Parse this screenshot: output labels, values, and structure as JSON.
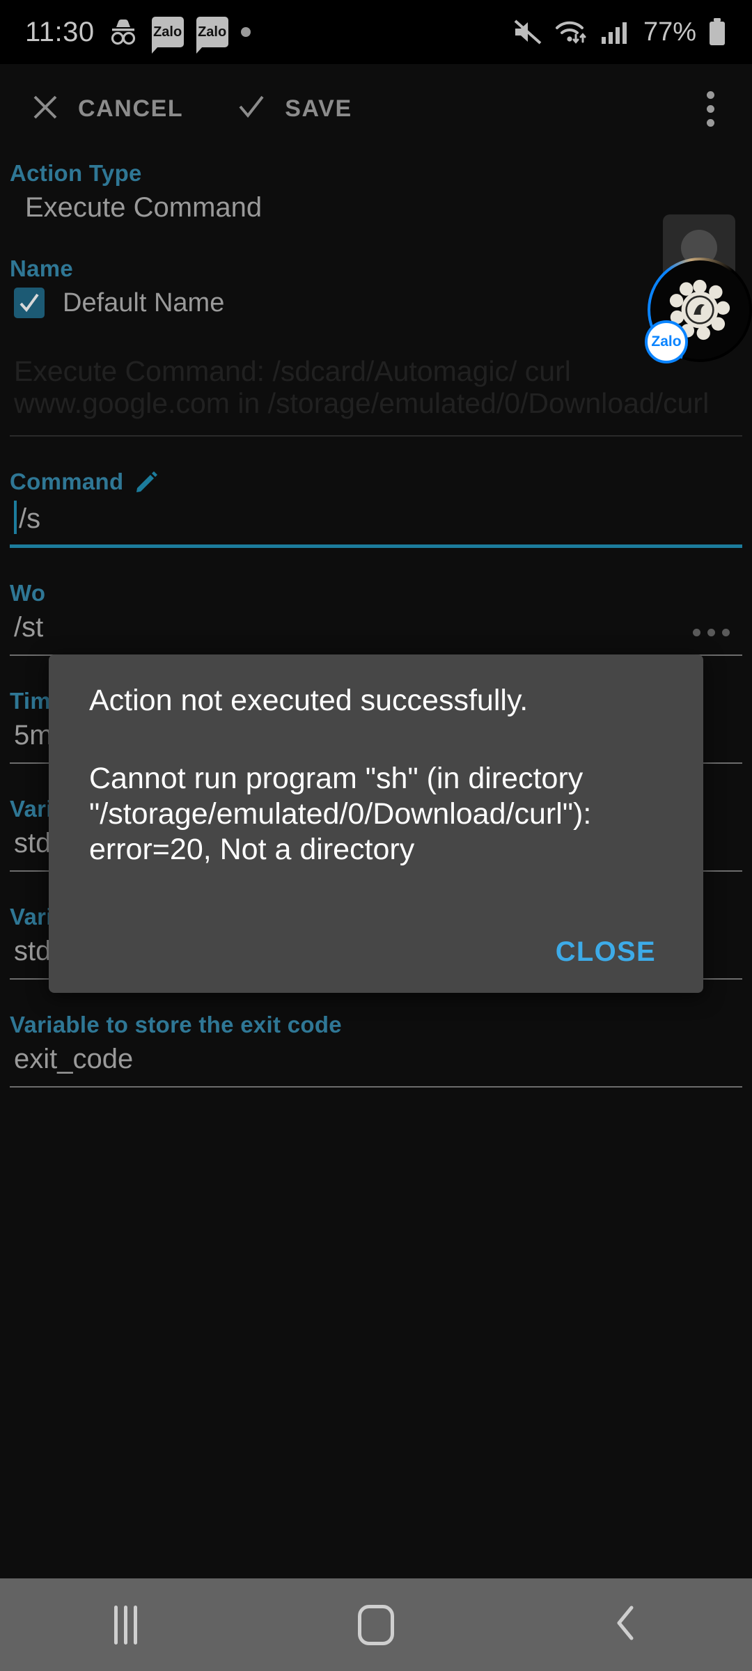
{
  "status_bar": {
    "time": "11:30",
    "icons": [
      "incognito-icon",
      "zalo-notification-icon",
      "zalo-notification-icon",
      "dot-icon"
    ],
    "zalo_label": "Zalo",
    "battery_percent": "77%",
    "right_icons": [
      "mute-icon",
      "wifi-icon",
      "signal-icon",
      "battery-icon"
    ]
  },
  "toolbar": {
    "cancel_label": "CANCEL",
    "save_label": "SAVE",
    "overflow_name": "more-options"
  },
  "form": {
    "action_type": {
      "label": "Action Type",
      "value": "Execute Command"
    },
    "name": {
      "label": "Name",
      "checkbox_label": "Default Name",
      "checked": true
    },
    "description": "Execute Command:  /sdcard/Automagic/ curl www.google.com\nin /storage/emulated/0/Download/curl",
    "command": {
      "label": "Command",
      "value": "/s"
    },
    "working_directory": {
      "label": "Wo",
      "value": "/st"
    },
    "timeout": {
      "label": "Tim",
      "value": "5m"
    },
    "stdout": {
      "label": "Variable to store the standard output",
      "value": "stdout"
    },
    "stderr": {
      "label": "Variable to store the error output",
      "value": "stderr"
    },
    "exit_code": {
      "label": "Variable to store the exit code",
      "value": "exit_code"
    }
  },
  "dialog": {
    "title": "Action not executed successfully.",
    "message": "Cannot run program \"sh\" (in directory \"/storage/emulated/0/Download/curl\"): error=20, Not a directory",
    "close_label": "CLOSE"
  },
  "chat_head": {
    "badge_label": "Zalo",
    "app_name": "zalo-chat-head"
  },
  "nav_bar": {
    "buttons": [
      "recents-button",
      "home-button",
      "back-button"
    ]
  },
  "colors": {
    "accent_label": "#2f7795",
    "focus": "#1c7c9c",
    "dialog_bg": "#474747",
    "dialog_action": "#3dabe8",
    "checkbox": "#1c5a74",
    "background": "#0d0d0d"
  }
}
